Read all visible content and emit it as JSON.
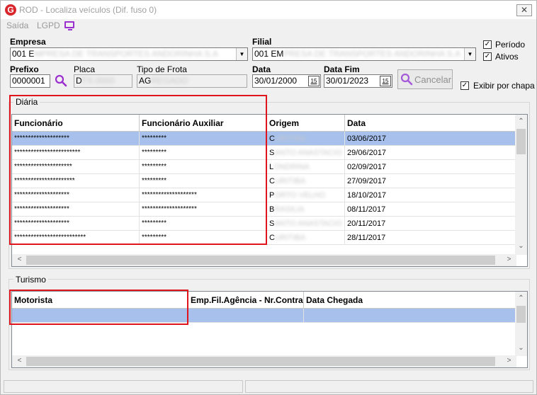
{
  "window": {
    "title": "ROD - Localiza veículos (Dif. fuso 0)",
    "icon": "G",
    "close": "✕"
  },
  "menu": {
    "saida": "Saída",
    "lgpd": "LGPD",
    "monitor_icon": "monitor-icon"
  },
  "filters": {
    "empresa_label": "Empresa",
    "empresa_value": "001 E",
    "empresa_blurred": "MPRESA DE TRANSPORTES ANDORINHA S.A",
    "filial_label": "Filial",
    "filial_value": "001 EM",
    "filial_blurred": "PRESA DE TRANSPORTES ANDORINHA S.A",
    "prefixo_label": "Prefixo",
    "prefixo_value": "0000001",
    "placa_label": "Placa",
    "placa_value": "D",
    "placa_blurred": "FX-0000",
    "tipo_frota_label": "Tipo de Frota",
    "tipo_frota_value": "AG",
    "tipo_frota_blurred": "REGADO",
    "data_label": "Data",
    "data_value": "30/01/2000",
    "data_fim_label": "Data Fim",
    "data_fim_value": "30/01/2023",
    "calendar_glyph": "15",
    "cancel_label": "Cancelar",
    "periodo_label": "Período",
    "ativos_label": "Ativos",
    "exibir_label": "Exibir por chapa",
    "check_mark": "✓"
  },
  "diaria": {
    "title": "Diária",
    "columns": [
      "Funcionário",
      "Funcionário Auxiliar",
      "Origem",
      "Data"
    ],
    "rows": [
      {
        "func": "********************",
        "aux": "*********",
        "origem": "C",
        "origem_blur": "URITIBA",
        "data": "03/06/2017"
      },
      {
        "func": "************************",
        "aux": "*********",
        "origem": "S",
        "origem_blur": "ANTO ANASTACIO",
        "data": "29/06/2017"
      },
      {
        "func": "*********************",
        "aux": "*********",
        "origem": "L",
        "origem_blur": "ONDRINA",
        "data": "02/09/2017"
      },
      {
        "func": "**********************",
        "aux": "*********",
        "origem": "C",
        "origem_blur": "URITIBA",
        "data": "27/09/2017"
      },
      {
        "func": "********************",
        "aux": "********************",
        "origem": "P",
        "origem_blur": "ORTO VELHO",
        "data": "18/10/2017"
      },
      {
        "func": "********************",
        "aux": "********************",
        "origem": "B",
        "origem_blur": "RASILIA",
        "data": "08/11/2017"
      },
      {
        "func": "********************",
        "aux": "*********",
        "origem": "S",
        "origem_blur": "ANTO ANASTACIO",
        "data": "20/11/2017"
      },
      {
        "func": "**************************",
        "aux": "*********",
        "origem": "C",
        "origem_blur": "URITIBA",
        "data": "28/11/2017"
      }
    ]
  },
  "turismo": {
    "title": "Turismo",
    "columns": [
      "Motorista",
      "Emp.Fil.Agência - Nr.Contra...",
      "Data Chegada"
    ]
  },
  "scroll": {
    "up": "⌃",
    "down": "⌄",
    "left": "<",
    "right": ">"
  },
  "colors": {
    "selection": "#a7c1ec",
    "highlight": "#e0141c",
    "accent": "#9b2fd0"
  }
}
